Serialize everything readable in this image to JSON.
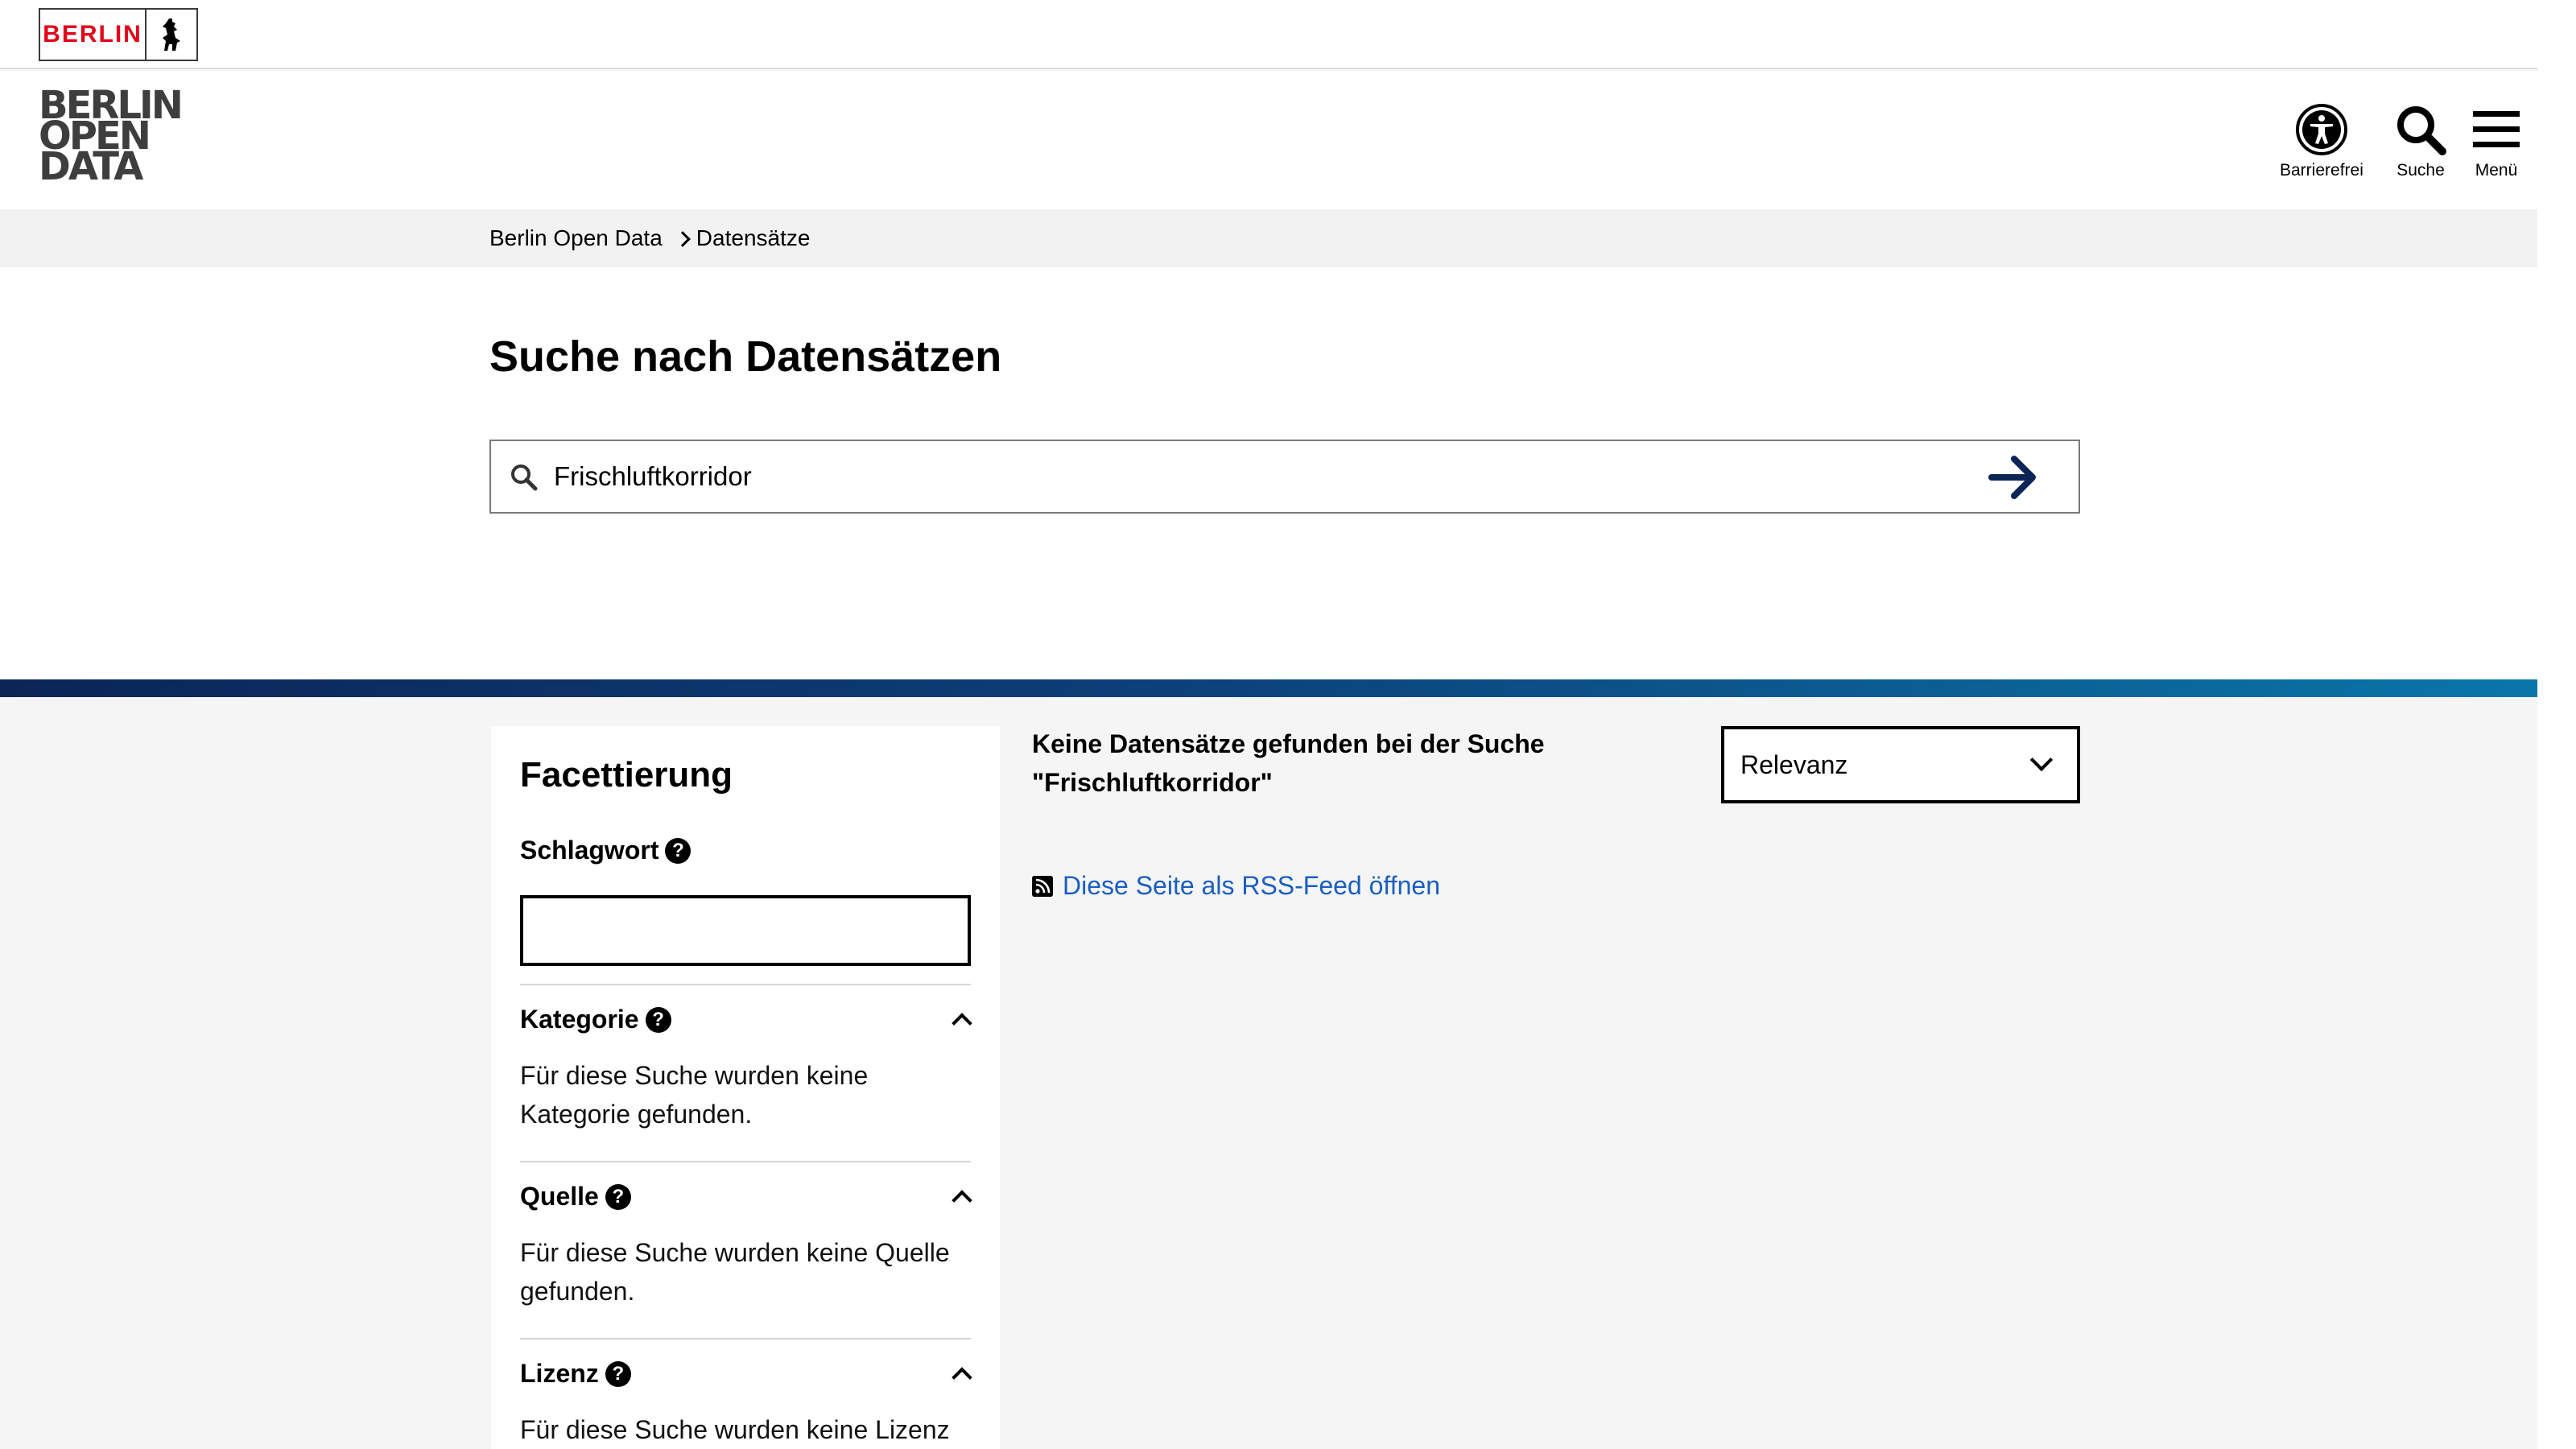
{
  "topbar": {
    "logo_text": "BERLIN"
  },
  "header": {
    "logo_lines": [
      "BERLIN",
      "OPEN",
      "DATA"
    ],
    "buttons": {
      "accessibility": "Barrierefrei",
      "search": "Suche",
      "menu": "Menü"
    }
  },
  "breadcrumb": {
    "items": [
      "Berlin Open Data",
      "Datensätze"
    ]
  },
  "search": {
    "title": "Suche nach Datensätzen",
    "query": "Frischluftkorridor"
  },
  "facets": {
    "title": "Facettierung",
    "keyword": {
      "label": "Schlagwort",
      "value": ""
    },
    "groups": [
      {
        "label": "Kategorie",
        "empty_text": "Für diese Suche wurden keine Kategorie gefunden."
      },
      {
        "label": "Quelle",
        "empty_text": "Für diese Suche wurden keine Quelle gefunden."
      },
      {
        "label": "Lizenz",
        "empty_text": "Für diese Suche wurden keine Lizenz"
      }
    ],
    "help_glyph": "?"
  },
  "results": {
    "message_line1": "Keine Datensätze gefunden bei der Suche",
    "message_line2": "\"Frischluftkorridor\"",
    "sort_value": "Relevanz",
    "rss_link": "Diese Seite als RSS-Feed öffnen"
  },
  "colors": {
    "berlin_red": "#e2001a",
    "link_blue": "#1a5ec0",
    "arrow_navy": "#0b2556"
  }
}
